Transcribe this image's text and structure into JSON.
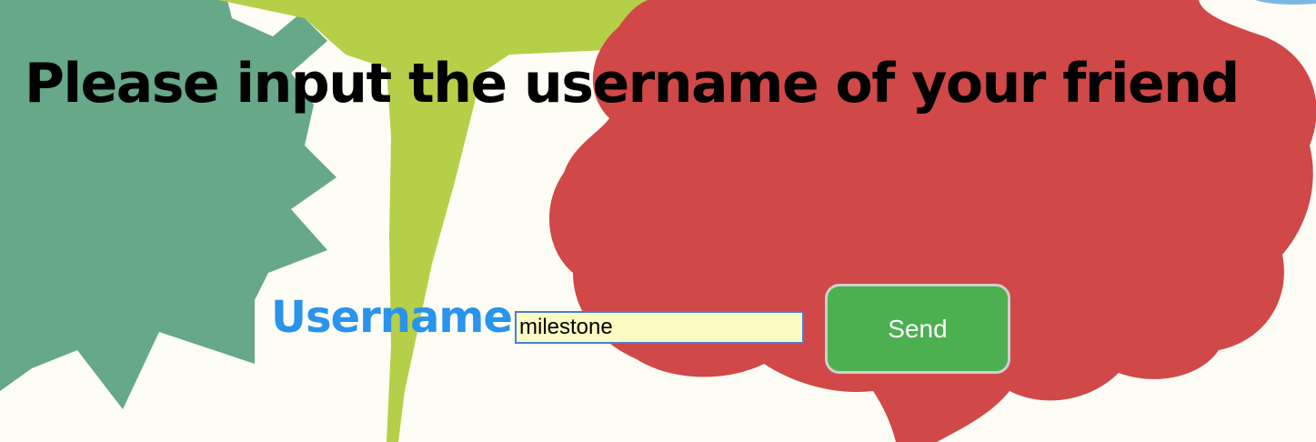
{
  "page": {
    "heading": "Please input the username of your friend"
  },
  "form": {
    "username_label": "Username",
    "username_value": "milestone",
    "send_label": "Send"
  },
  "colors": {
    "background": "#fdfdf5",
    "green_shape": "#66a888",
    "lime_shape": "#b6cf48",
    "red_shape": "#d14848",
    "label_blue": "#2a93ec",
    "input_bg": "#fafcc4",
    "button_green": "#4caf50"
  }
}
